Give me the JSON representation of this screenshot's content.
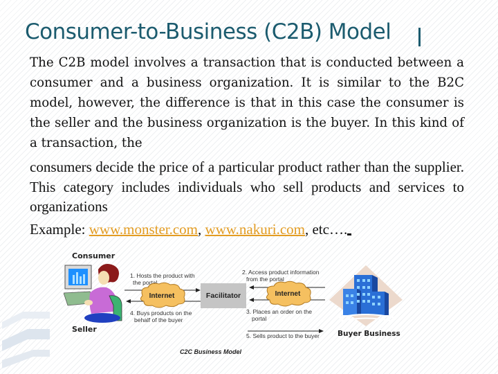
{
  "slide": {
    "title": "Consumer-to-Business (C2B) Model",
    "paragraph1": "The C2B model involves a transaction that is conducted between a consumer and a business organization. It is similar to the B2C model, however, the difference is that in this case the consumer is the seller and the business organization is the buyer. In this kind of a transaction, the",
    "paragraph2": "consumers decide the price of a particular product rather than the supplier. This category includes individuals who sell products and services to organizations",
    "example": {
      "prefix": "Example: ",
      "links": [
        "www.monster.com",
        "www.nakuri.com"
      ],
      "separator": ", ",
      "suffix": ", etc…."
    },
    "colors": {
      "title": "#1b5b6e",
      "link": "#e39c22"
    }
  },
  "diagram": {
    "consumer_label": "Consumer",
    "seller_label": "Seller",
    "facilitator_label": "Facilitator",
    "internet_label": "Internet",
    "buyer_label": "Buyer Business",
    "step1": [
      "1. Hosts the product with",
      "the portal"
    ],
    "step2": [
      "2. Access product information",
      "from the portal"
    ],
    "step3": [
      "3. Places an order on the",
      "portal"
    ],
    "step4": [
      "4. Buys products on the",
      "behalf of the buyer"
    ],
    "step5": "5. Sells product to the buyer",
    "caption": "C2C Business Model"
  }
}
